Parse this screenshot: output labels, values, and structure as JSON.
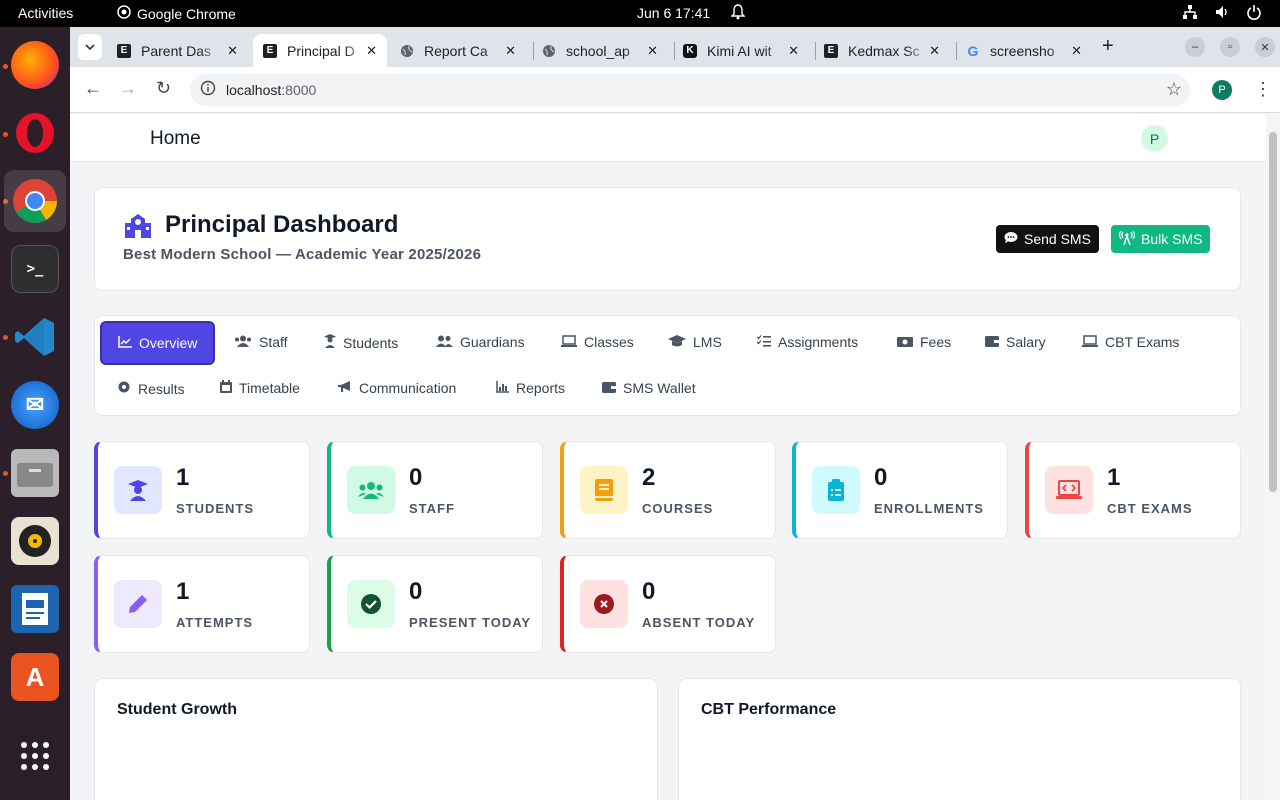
{
  "system": {
    "activities": "Activities",
    "app_name": "Google Chrome",
    "clock": "Jun 6  17:41"
  },
  "browser": {
    "tabs": [
      {
        "title": "Parent Das",
        "favicon": "E"
      },
      {
        "title": "Principal D",
        "favicon": "E"
      },
      {
        "title": "Report Ca",
        "favicon": "globe"
      },
      {
        "title": "school_ap",
        "favicon": "globe"
      },
      {
        "title": "Kimi AI wit",
        "favicon": "K"
      },
      {
        "title": "Kedmax Sc",
        "favicon": "E"
      },
      {
        "title": "screensho",
        "favicon": "G"
      }
    ],
    "active_tab": 1,
    "url_host": "localhost",
    "url_port": ":8000",
    "profile_initial": "P"
  },
  "app": {
    "header_title": "Home",
    "avatar_initial": "P",
    "dashboard_title": "Principal Dashboard",
    "subtitle": "Best Modern School — Academic Year 2025/2026",
    "send_sms": "Send SMS",
    "bulk_sms": "Bulk SMS",
    "nav_tabs": [
      "Overview",
      "Staff",
      "Students",
      "Guardians",
      "Classes",
      "LMS",
      "Assignments",
      "Fees",
      "Salary",
      "CBT Exams",
      "Results",
      "Timetable",
      "Communication",
      "Reports",
      "SMS Wallet"
    ],
    "stats": [
      {
        "value": "1",
        "label": "STUDENTS",
        "color": "#4f46e5",
        "icon": "graduate-icon"
      },
      {
        "value": "0",
        "label": "STAFF",
        "color": "#10b981",
        "icon": "users-icon"
      },
      {
        "value": "2",
        "label": "COURSES",
        "color": "#f59e0b",
        "icon": "book-icon"
      },
      {
        "value": "0",
        "label": "ENROLLMENTS",
        "color": "#06b6d4",
        "icon": "clipboard-icon"
      },
      {
        "value": "1",
        "label": "CBT EXAMS",
        "color": "#ef4444",
        "icon": "laptop-code-icon"
      },
      {
        "value": "1",
        "label": "ATTEMPTS",
        "color": "#8b5cf6",
        "icon": "pen-icon"
      },
      {
        "value": "0",
        "label": "PRESENT TODAY",
        "color": "#16a34a",
        "icon": "check-circle-icon"
      },
      {
        "value": "0",
        "label": "ABSENT TODAY",
        "color": "#dc2626",
        "icon": "x-circle-icon"
      }
    ],
    "panels": [
      "Student Growth",
      "CBT Performance"
    ]
  }
}
